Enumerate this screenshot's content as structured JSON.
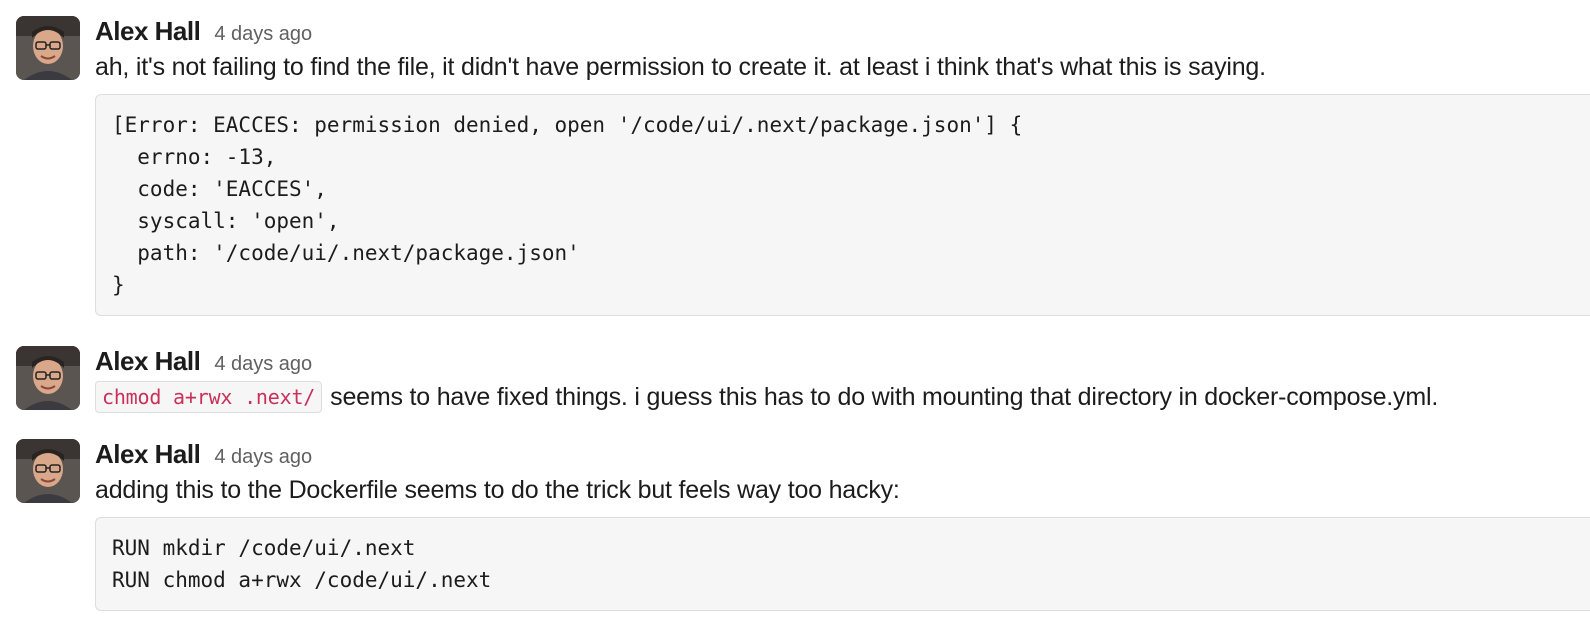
{
  "messages": [
    {
      "author": "Alex Hall",
      "timestamp": "4 days ago",
      "text": "ah, it's not failing to find the file, it didn't have permission to create it. at least i think that's what this is saying.",
      "code_block": "[Error: EACCES: permission denied, open '/code/ui/.next/package.json'] {\n  errno: -13,\n  code: 'EACCES',\n  syscall: 'open',\n  path: '/code/ui/.next/package.json'\n}"
    },
    {
      "author": "Alex Hall",
      "timestamp": "4 days ago",
      "inline_code": "chmod a+rwx .next/",
      "text": "seems to have fixed things. i guess this has to do with mounting that directory in docker-compose.yml."
    },
    {
      "author": "Alex Hall",
      "timestamp": "4 days ago",
      "text": "adding this to the Dockerfile seems to do the trick but feels way too hacky:",
      "code_block": "RUN mkdir /code/ui/.next\nRUN chmod a+rwx /code/ui/.next"
    }
  ],
  "colors": {
    "inline_code_text": "#c9305a",
    "code_background": "#f6f6f6",
    "timestamp": "#616061"
  },
  "icons": {
    "avatar": "user-avatar-photo"
  }
}
